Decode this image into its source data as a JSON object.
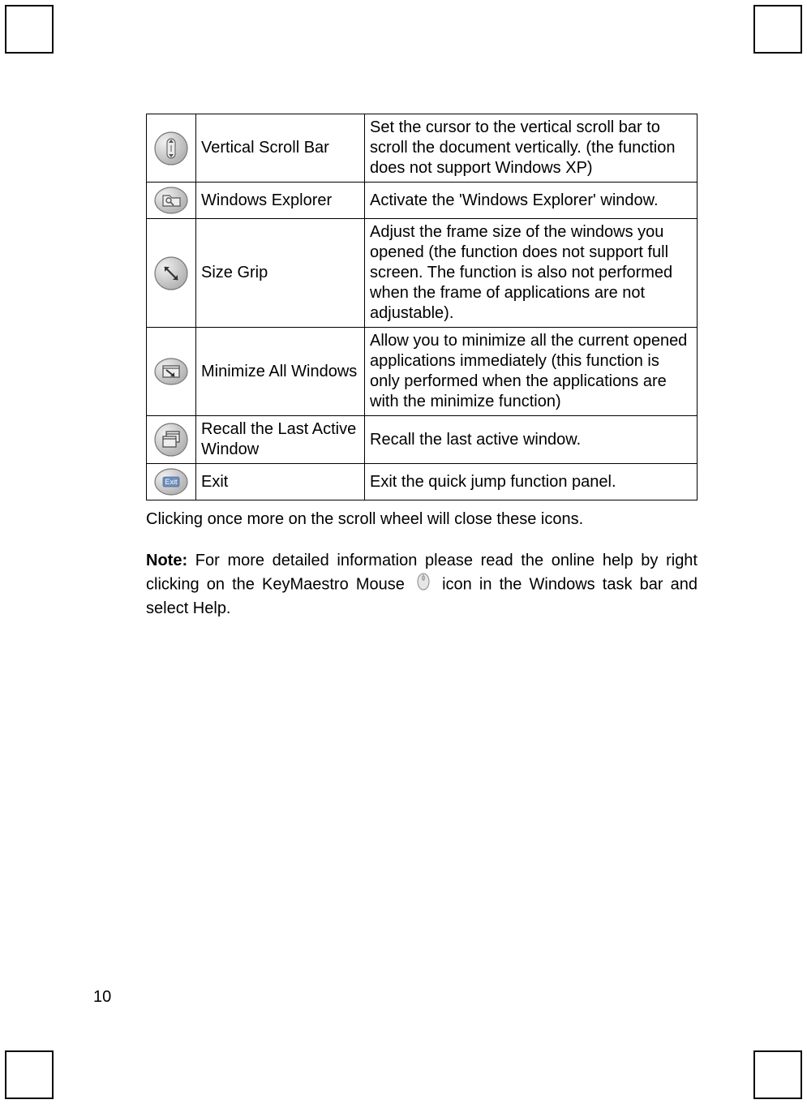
{
  "table": {
    "rows": [
      {
        "name": "Vertical Scroll Bar",
        "desc": "Set the cursor to the vertical scroll bar to scroll the document vertically. (the function does not support Windows XP)"
      },
      {
        "name": "Windows Explorer",
        "desc": "Activate the 'Windows Explorer' window."
      },
      {
        "name": "Size Grip",
        "desc": "Adjust the frame size of the windows you opened (the function does not support full screen. The function is also not performed when the frame of applications are not adjustable)."
      },
      {
        "name": "Minimize All Windows",
        "desc": "Allow you to minimize all the current opened applications immediately (this function is only performed when the applications are with the minimize function)"
      },
      {
        "name": "Recall the Last Active Window",
        "desc": "Recall the last active window."
      },
      {
        "name": "Exit",
        "desc": "Exit the quick jump function panel."
      }
    ]
  },
  "below_text": "Clicking once more on the scroll wheel will close these icons.",
  "note": {
    "label": "Note:",
    "before_icon": "For more detailed information please read the online help by right clicking on the KeyMaestro Mouse",
    "after_icon": "icon  in the Windows task bar and select Help."
  },
  "page_number": "10",
  "exit_text": "Exit"
}
